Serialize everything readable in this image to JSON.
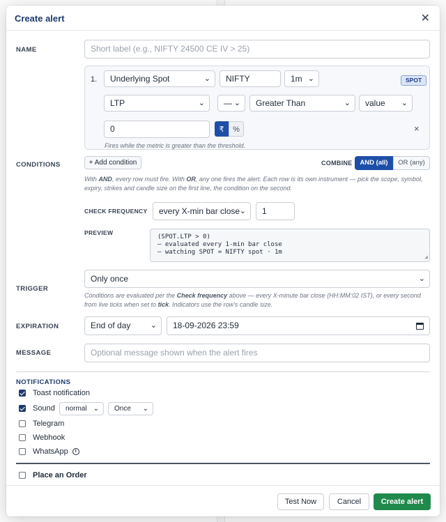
{
  "modal": {
    "title": "Create alert",
    "close_glyph": "✕"
  },
  "name": {
    "label": "NAME",
    "placeholder": "Short label (e.g., NIFTY 24500 CE IV > 25)",
    "value": ""
  },
  "condition_row": {
    "index": "1.",
    "scope": "Underlying Spot",
    "symbol": "NIFTY",
    "interval": "1m",
    "badge": "SPOT",
    "metric": "LTP",
    "modifier": "—",
    "operator": "Greater Than",
    "compare_type": "value",
    "threshold": "0",
    "unit_rupee": "₹",
    "unit_percent": "%",
    "remove_glyph": "×",
    "hint": "Fires while the metric is greater than the threshold."
  },
  "conditions": {
    "label": "CONDITIONS",
    "add_button": "+ Add condition",
    "combine_label": "COMBINE",
    "combine_and": "AND (all)",
    "combine_or": "OR (any)",
    "help_1": "With",
    "help_and": "AND",
    "help_2": ", every row must fire. With",
    "help_or": "OR",
    "help_3": ", any one fires the alert. Each row is its own instrument — pick the scope, symbol, expiry, strikes and candle size on the first line, the condition on the second."
  },
  "check_frequency": {
    "label": "CHECK FREQUENCY",
    "mode": "every X-min bar close",
    "minutes": "1"
  },
  "preview": {
    "label": "PREVIEW",
    "text": "(SPOT.LTP > 0)\n— evaluated every 1-min bar close\n— watching SPOT = NIFTY spot · 1m"
  },
  "trigger": {
    "label": "TRIGGER",
    "value": "Only once",
    "help_1": "Conditions are evaluated per the",
    "help_bold_1": "Check frequency",
    "help_2": "above — every X-minute bar close (HH:MM:02 IST), or every second from live ticks when set to",
    "help_bold_2": "tick",
    "help_3": ". Indicators use the row's candle size."
  },
  "expiration": {
    "label": "EXPIRATION",
    "mode": "End of day",
    "datetime": "18-09-2026 23:59"
  },
  "message": {
    "label": "MESSAGE",
    "placeholder": "Optional message shown when the alert fires"
  },
  "notifications": {
    "label": "NOTIFICATIONS",
    "toast": "Toast notification",
    "sound": "Sound",
    "sound_level": "normal",
    "sound_repeat": "Once",
    "telegram": "Telegram",
    "webhook": "Webhook",
    "whatsapp": "WhatsApp",
    "toast_checked": true,
    "sound_checked": true
  },
  "order": {
    "label": "Place an Order"
  },
  "footer": {
    "test": "Test Now",
    "cancel": "Cancel",
    "create": "Create alert"
  },
  "colors": {
    "accent": "#1e4fa8",
    "title": "#1e3a6e",
    "create": "#1f8a4c"
  }
}
